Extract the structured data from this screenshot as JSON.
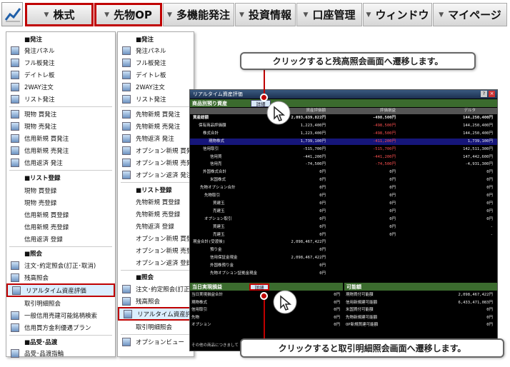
{
  "menubar": {
    "items": [
      {
        "label": "株式",
        "selected": true
      },
      {
        "label": "先物OP",
        "selected": true
      },
      {
        "label": "多機能発注",
        "selected": false
      },
      {
        "label": "投資情報",
        "selected": false
      },
      {
        "label": "口座管理",
        "selected": false
      },
      {
        "label": "ウィンドウ",
        "selected": false
      },
      {
        "label": "マイページ",
        "selected": false
      }
    ]
  },
  "menu_stock": {
    "h_order": "■発注",
    "order_panel": "発注パネル",
    "full_board": "フル板発注",
    "daytrade_board": "デイトレ板",
    "two_way": "2WAY注文",
    "list_order": "リスト発注",
    "spot_buy": "現物 買発注",
    "spot_sell": "現物 売発注",
    "margin_new_buy": "信用新規 買発注",
    "margin_new_sell": "信用新規 売発注",
    "margin_close": "信用返済 発注",
    "h_list": "■リスト登録",
    "list_spot_buy": "現物 買登録",
    "list_spot_sell": "現物 売登録",
    "list_margin_buy": "信用新規 買登録",
    "list_margin_sell": "信用新規 売登録",
    "list_margin_close": "信用返済 登録",
    "h_inquiry": "■照会",
    "order_inquiry": "注文･約定照会(訂正･取消)",
    "balance_inquiry": "残高照会",
    "realtime_eval": "リアルタイム資産評価",
    "transaction": "取引明細照会",
    "margin_search": "一般信用売建可能銘柄検索",
    "margin_plan": "信用買方金利優遇プラン",
    "h_lending": "■品受･品渡",
    "lending": "品受･品渡指輪"
  },
  "menu_futures": {
    "h_order": "■発注",
    "order_panel": "発注パネル",
    "full_board": "フル板発注",
    "daytrade_board": "デイトレ板",
    "two_way": "2WAY注文",
    "list_order": "リスト発注",
    "fut_new_buy": "先物新規 買発注",
    "fut_new_sell": "先物新規 売発注",
    "fut_close": "先物返済 発注",
    "opt_new_buy": "オプション新規 買発注",
    "opt_new_sell": "オプション新規 売発注",
    "opt_close": "オプション返済 発注",
    "h_list": "■リスト登録",
    "list_fut_buy": "先物新規 買登録",
    "list_fut_sell": "先物新規 売登録",
    "list_fut_close": "先物返済 登録",
    "list_opt_buy": "オプション新規 買登録",
    "list_opt_sell": "オプション新規 売登録",
    "list_opt_close": "オプション返済 登録",
    "h_inquiry": "■照会",
    "order_inquiry": "注文･約定照会(訂正･取消)",
    "balance_inquiry": "残高照会",
    "realtime_eval": "リアルタイム資産評価",
    "transaction": "取引明細照会",
    "option_view": "オプションビュー"
  },
  "callouts": {
    "top": "クリックすると残高照会画面へ遷移します。",
    "bottom": "クリックすると取引明細照会画面へ遷移します。"
  },
  "window": {
    "title": "リアルタイム資産評価",
    "section1": "商品別預り資産",
    "detail_label": "詳細",
    "headers": [
      "資産評価額",
      "評価損益",
      "デルタ"
    ],
    "rows": [
      {
        "label": "資産総額",
        "v1": "2,093,639,822円",
        "v2": "-498,500円",
        "v3": "144,250,400円"
      },
      {
        "label": "保有商品評価額",
        "v1": "1,223,400円",
        "v2": "-498,500円",
        "v3": "144,250,400円"
      },
      {
        "label": "株式合計",
        "v1": "1,223,400円",
        "v2": "-498,500円",
        "v3": "144,250,400円"
      },
      {
        "label": "現物株式",
        "v1": "1,739,100円",
        "v2": "-411,200円",
        "v3": "1,739,100円"
      },
      {
        "label": "信用取引",
        "v1": "-515,700円",
        "v2": "-515,700円",
        "v3": "142,511,300円"
      },
      {
        "label": "信用買",
        "v1": "-441,200円",
        "v2": "-441,200円",
        "v3": "147,442,600円"
      },
      {
        "label": "信用売",
        "v1": "-74,500円",
        "v2": "-74,500円",
        "v3": "-4,931,300円"
      },
      {
        "label": "外国株式合計",
        "v1": "0円",
        "v2": "0円",
        "v3": "0円"
      },
      {
        "label": "米国株式",
        "v1": "0円",
        "v2": "0円",
        "v3": "0円"
      },
      {
        "label": "先物オプション合計",
        "v1": "0円",
        "v2": "0円",
        "v3": "0円"
      },
      {
        "label": "先物取引",
        "v1": "0円",
        "v2": "0円",
        "v3": "0円"
      },
      {
        "label": "買建玉",
        "v1": "0円",
        "v2": "0円",
        "v3": "0円"
      },
      {
        "label": "売建玉",
        "v1": "0円",
        "v2": "0円",
        "v3": "0円"
      },
      {
        "label": "オプション取引",
        "v1": "0円",
        "v2": "0円",
        "v3": "0円"
      },
      {
        "label": "買建玉",
        "v1": "0円",
        "v2": "0円",
        "v3": "-"
      },
      {
        "label": "売建玉",
        "v1": "0円",
        "v2": "0円",
        "v3": "-"
      },
      {
        "label": "現金合計(受渡後)",
        "v1": "2,098,467,422円",
        "v2": "",
        "v3": ""
      },
      {
        "label": "預り金",
        "v1": "0円",
        "v2": "",
        "v3": ""
      },
      {
        "label": "信用保証金現金",
        "v1": "2,098,467,422円",
        "v2": "",
        "v3": ""
      },
      {
        "label": "外国株預り金",
        "v1": "0円",
        "v2": "",
        "v3": ""
      },
      {
        "label": "先物オプション証拠金現金",
        "v1": "0円",
        "v2": "",
        "v3": ""
      }
    ],
    "section2_left": "当日実現損益",
    "section2_right": "可能額",
    "pl_rows": [
      {
        "label": "当日実現損益合計",
        "v": "0円"
      },
      {
        "label": "現物株式",
        "v": "0円"
      },
      {
        "label": "信用取引",
        "v": "0円"
      },
      {
        "label": "先物",
        "v": "0円"
      },
      {
        "label": "オプション",
        "v": "0円"
      }
    ],
    "avail_rows": [
      {
        "label": "現物買付可能額",
        "v": "2,098,467,422円"
      },
      {
        "label": "信用新規建可能額",
        "v": "6,433,471,083円"
      },
      {
        "label": "米国買付可能額",
        "v": "0円"
      },
      {
        "label": "先物新規建可能額",
        "v": "0円"
      },
      {
        "label": "OP新規買建可能額",
        "v": "0円"
      }
    ],
    "footer": "その他の商品につきまして"
  },
  "colors": {
    "accent": "#c00000",
    "green_bar": "#3b6b2e",
    "highlight_row": "#16167a"
  }
}
